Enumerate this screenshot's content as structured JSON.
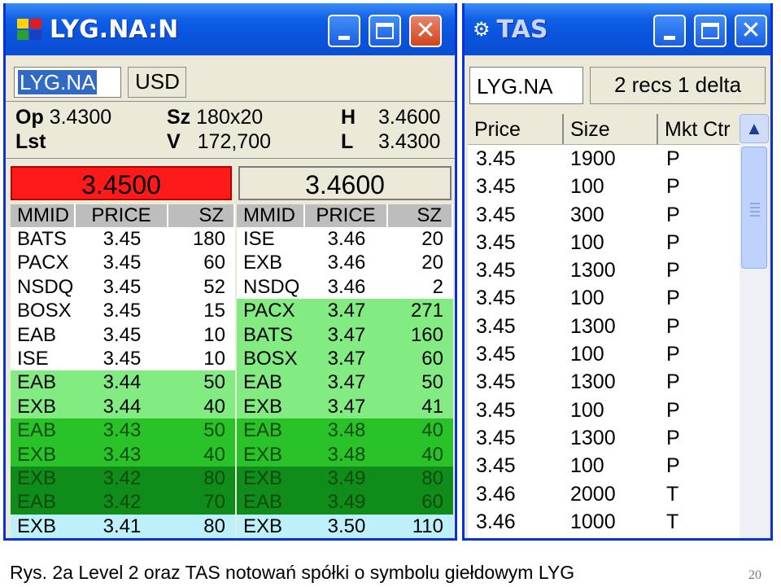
{
  "level2": {
    "title": "LYG.NA:N",
    "symbol_input": "LYG.NA",
    "currency_tab": "USD",
    "quote": {
      "op_label": "Op",
      "op_value": "3.4300",
      "lst_label": "Lst",
      "sz_label": "Sz",
      "sz_value": "180x20",
      "v_label": "V",
      "v_value": "172,700",
      "h_label": "H",
      "h_value": "3.4600",
      "l_label": "L",
      "l_value": "3.4300"
    },
    "best_bid": "3.4500",
    "best_ask": "3.4600",
    "columns": [
      "MMID",
      "PRICE",
      "SZ"
    ],
    "bids": [
      {
        "mmid": "BATS",
        "price": "3.45",
        "size": "180",
        "color": "#ffffff"
      },
      {
        "mmid": "PACX",
        "price": "3.45",
        "size": "60",
        "color": "#ffffff"
      },
      {
        "mmid": "NSDQ",
        "price": "3.45",
        "size": "52",
        "color": "#ffffff"
      },
      {
        "mmid": "BOSX",
        "price": "3.45",
        "size": "15",
        "color": "#ffffff"
      },
      {
        "mmid": "EAB",
        "price": "3.45",
        "size": "10",
        "color": "#ffffff"
      },
      {
        "mmid": "ISE",
        "price": "3.45",
        "size": "10",
        "color": "#ffffff"
      },
      {
        "mmid": "EAB",
        "price": "3.44",
        "size": "50",
        "color": "#82ec82"
      },
      {
        "mmid": "EXB",
        "price": "3.44",
        "size": "40",
        "color": "#82ec82"
      },
      {
        "mmid": "EAB",
        "price": "3.43",
        "size": "50",
        "color": "#29c229"
      },
      {
        "mmid": "EXB",
        "price": "3.43",
        "size": "40",
        "color": "#29c229"
      },
      {
        "mmid": "EXB",
        "price": "3.42",
        "size": "80",
        "color": "#0f8c1a"
      },
      {
        "mmid": "EAB",
        "price": "3.42",
        "size": "70",
        "color": "#0f8c1a"
      },
      {
        "mmid": "EXB",
        "price": "3.41",
        "size": "80",
        "color": "#bdf0fb"
      }
    ],
    "asks": [
      {
        "mmid": "ISE",
        "price": "3.46",
        "size": "20",
        "color": "#ffffff"
      },
      {
        "mmid": "EXB",
        "price": "3.46",
        "size": "20",
        "color": "#ffffff"
      },
      {
        "mmid": "NSDQ",
        "price": "3.46",
        "size": "2",
        "color": "#ffffff"
      },
      {
        "mmid": "PACX",
        "price": "3.47",
        "size": "271",
        "color": "#82ec82"
      },
      {
        "mmid": "BATS",
        "price": "3.47",
        "size": "160",
        "color": "#82ec82"
      },
      {
        "mmid": "BOSX",
        "price": "3.47",
        "size": "60",
        "color": "#82ec82"
      },
      {
        "mmid": "EAB",
        "price": "3.47",
        "size": "50",
        "color": "#82ec82"
      },
      {
        "mmid": "EXB",
        "price": "3.47",
        "size": "41",
        "color": "#82ec82"
      },
      {
        "mmid": "EAB",
        "price": "3.48",
        "size": "40",
        "color": "#29c229"
      },
      {
        "mmid": "EXB",
        "price": "3.48",
        "size": "40",
        "color": "#29c229"
      },
      {
        "mmid": "EXB",
        "price": "3.49",
        "size": "80",
        "color": "#0f8c1a"
      },
      {
        "mmid": "EAB",
        "price": "3.49",
        "size": "60",
        "color": "#0f8c1a"
      },
      {
        "mmid": "EXB",
        "price": "3.50",
        "size": "110",
        "color": "#bdf0fb"
      }
    ]
  },
  "tas": {
    "title": "TAS",
    "symbol": "LYG.NA",
    "info": "2 recs 1 delta",
    "columns": [
      "Price",
      "Size",
      "Mkt Ctr"
    ],
    "trades": [
      {
        "price": "3.45",
        "size": "1900",
        "mkt": "P"
      },
      {
        "price": "3.45",
        "size": "100",
        "mkt": "P"
      },
      {
        "price": "3.45",
        "size": "300",
        "mkt": "P"
      },
      {
        "price": "3.45",
        "size": "100",
        "mkt": "P"
      },
      {
        "price": "3.45",
        "size": "1300",
        "mkt": "P"
      },
      {
        "price": "3.45",
        "size": "100",
        "mkt": "P"
      },
      {
        "price": "3.45",
        "size": "1300",
        "mkt": "P"
      },
      {
        "price": "3.45",
        "size": "100",
        "mkt": "P"
      },
      {
        "price": "3.45",
        "size": "1300",
        "mkt": "P"
      },
      {
        "price": "3.45",
        "size": "100",
        "mkt": "P"
      },
      {
        "price": "3.45",
        "size": "1300",
        "mkt": "P"
      },
      {
        "price": "3.45",
        "size": "100",
        "mkt": "P"
      },
      {
        "price": "3.46",
        "size": "2000",
        "mkt": "T"
      },
      {
        "price": "3.46",
        "size": "1000",
        "mkt": "T"
      }
    ]
  },
  "window_buttons": {
    "minimize": "minimize-icon",
    "maximize": "maximize-icon",
    "close": "close-icon"
  },
  "caption": "Rys. 2a Level 2 oraz TAS notowań spółki o symbolu giełdowym LYG",
  "page_number": "20"
}
